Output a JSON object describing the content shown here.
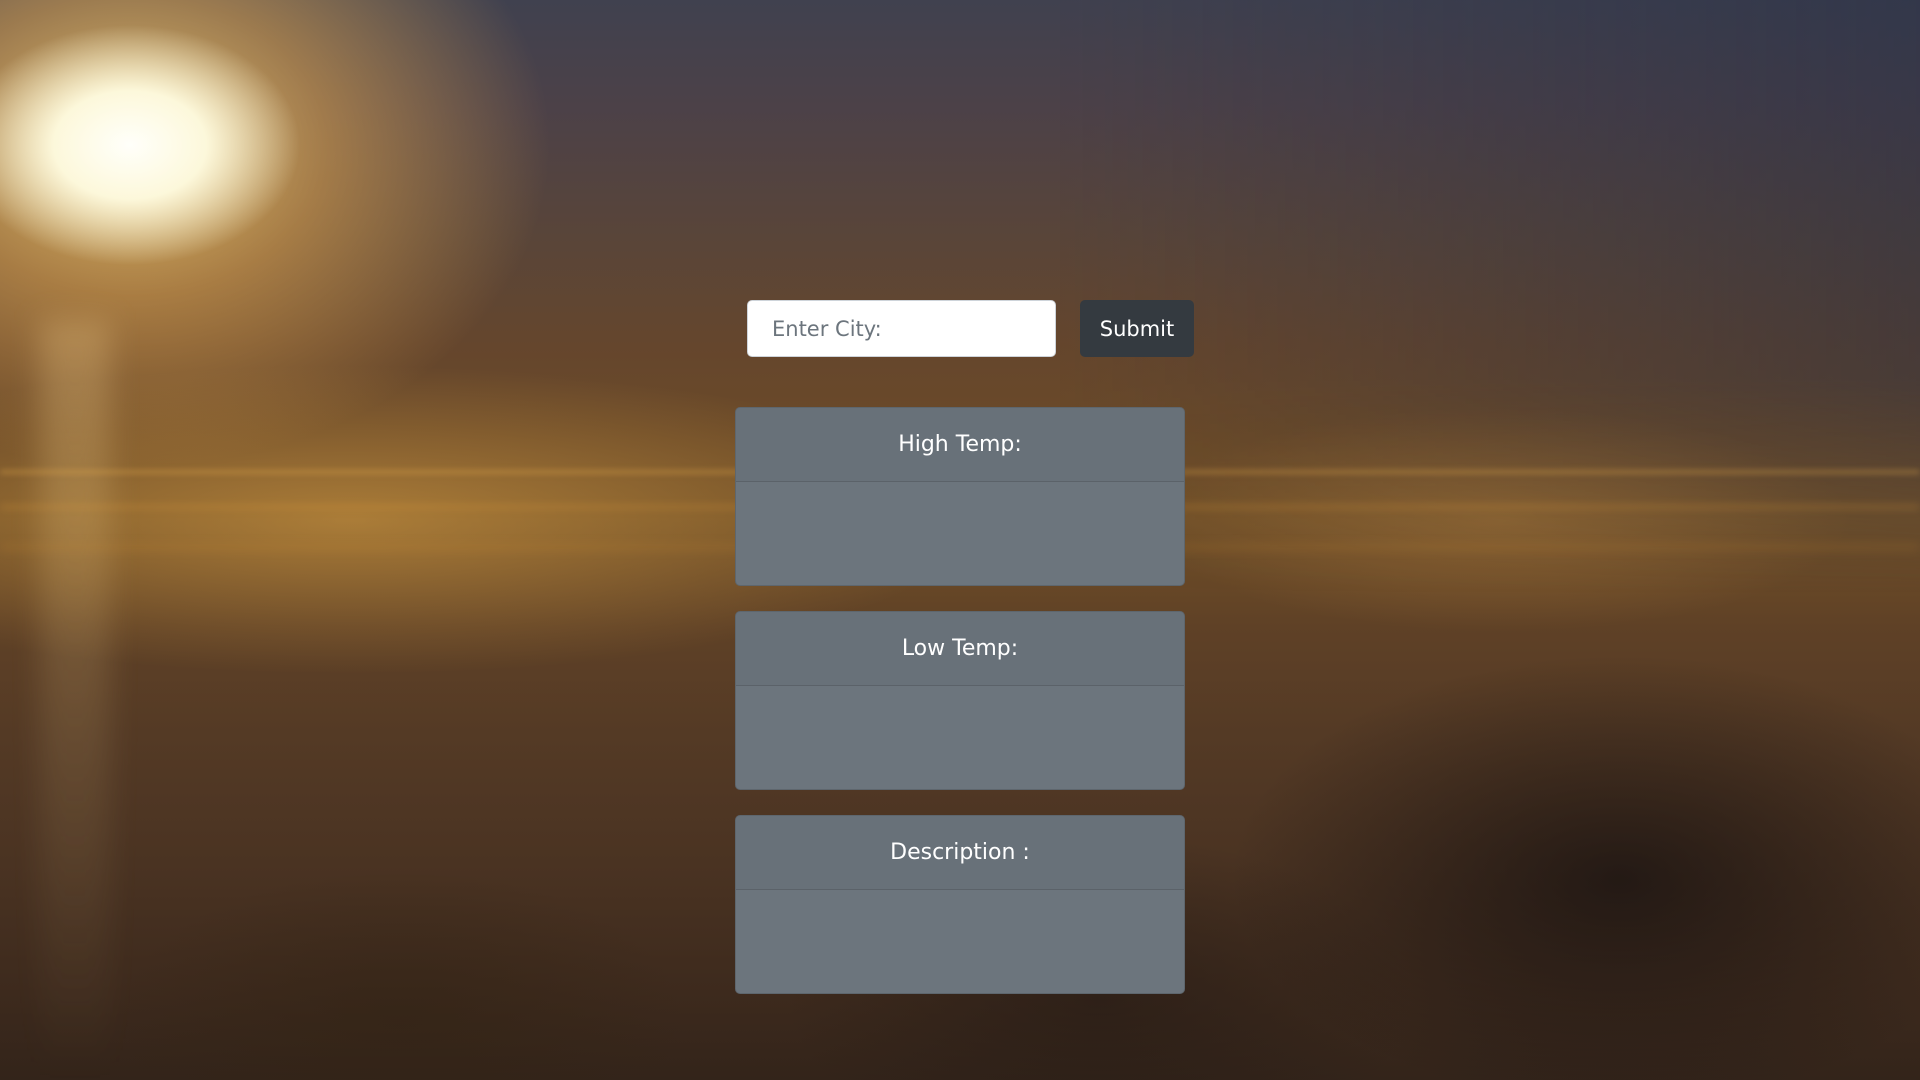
{
  "search": {
    "placeholder": "Enter City:",
    "value": "",
    "submit_label": "Submit"
  },
  "cards": [
    {
      "header": "High Temp:",
      "body": ""
    },
    {
      "header": "Low Temp:",
      "body": ""
    },
    {
      "header": "Description :",
      "body": ""
    }
  ],
  "colors": {
    "card_background": "#6c757d",
    "button_background": "#343a40",
    "input_background": "#ffffff",
    "text_on_dark": "#ffffff"
  },
  "background": {
    "icon": "sunset-clouds-photo"
  }
}
